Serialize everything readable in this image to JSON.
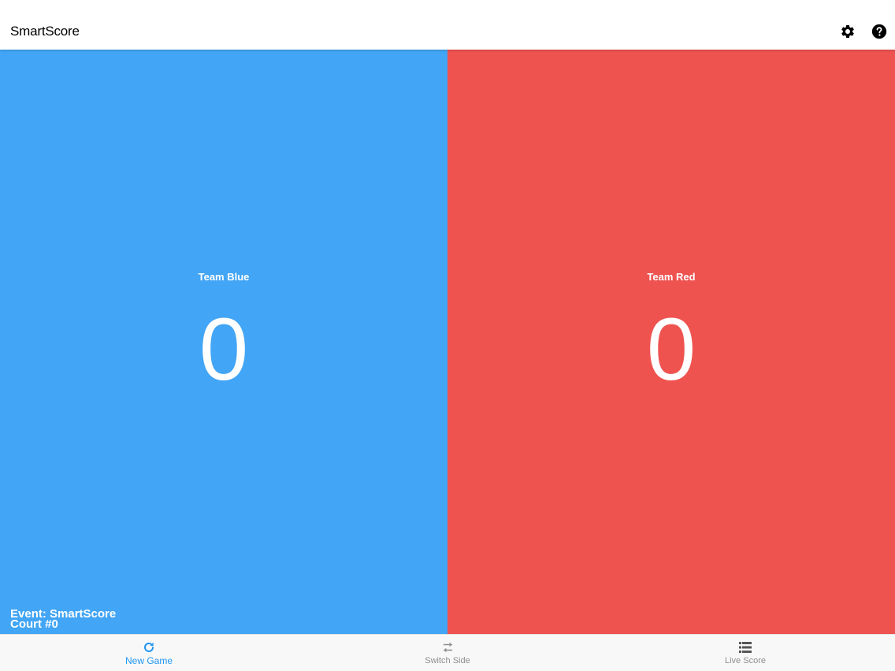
{
  "header": {
    "title": "SmartScore",
    "settings_icon": "gear-icon",
    "help_icon": "help-circle-icon"
  },
  "teams": [
    {
      "name": "Team Blue",
      "score": "0",
      "color": "#42A5F5"
    },
    {
      "name": "Team Red",
      "score": "0",
      "color": "#EF5350"
    }
  ],
  "event": {
    "event_line": "Event: SmartScore",
    "court_line": "Court #0"
  },
  "tabs": [
    {
      "label": "New Game",
      "icon": "refresh-icon",
      "active": true
    },
    {
      "label": "Switch Side",
      "icon": "swap-arrows-icon",
      "active": false
    },
    {
      "label": "Live Score",
      "icon": "list-icon",
      "active": false
    }
  ],
  "colors": {
    "accent": "#2196F3",
    "inactive_tab": "#8e8e8e"
  }
}
